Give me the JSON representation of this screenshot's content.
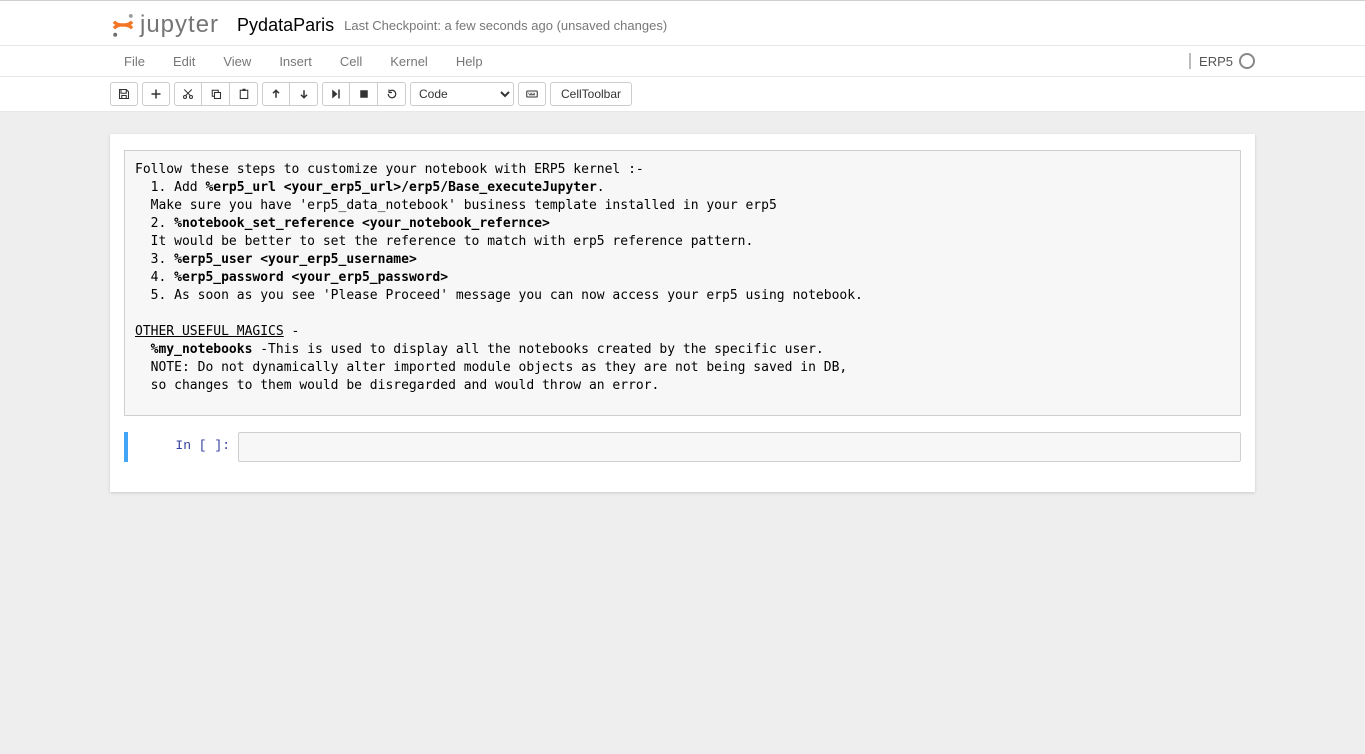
{
  "header": {
    "logo_word": "jupyter",
    "notebook_title": "PydataParis",
    "checkpoint_text": "Last Checkpoint: a few seconds ago (unsaved changes)"
  },
  "menubar": {
    "items": [
      "File",
      "Edit",
      "View",
      "Insert",
      "Cell",
      "Kernel",
      "Help"
    ],
    "kernel_name": "ERP5"
  },
  "toolbar": {
    "cell_type_selected": "Code",
    "celltoolbar_label": "CellToolbar"
  },
  "output": {
    "line_intro": "Follow these steps to customize your notebook with ERP5 kernel :-",
    "step1_prefix": "  1. Add ",
    "step1_bold": "%erp5_url <your_erp5_url>/erp5/Base_executeJupyter",
    "step1_suffix": ".",
    "step1_sub": "  Make sure you have 'erp5_data_notebook' business template installed in your erp5",
    "step2_prefix": "  2. ",
    "step2_bold": "%notebook_set_reference <your_notebook_refernce>",
    "step2_sub": "  It would be better to set the reference to match with erp5 reference pattern.",
    "step3_prefix": "  3. ",
    "step3_bold": "%erp5_user <your_erp5_username>",
    "step4_prefix": "  4. ",
    "step4_bold": "%erp5_password <your_erp5_password>",
    "step5": "  5. As soon as you see 'Please Proceed' message you can now access your erp5 using notebook.",
    "other_header_u": "OTHER USEFUL MAGICS",
    "other_header_suffix": " -",
    "mynb_prefix": "  ",
    "mynb_bold": "%my_notebooks",
    "mynb_desc": " -This is used to display all the notebooks created by the specific user.",
    "note_line1": "  NOTE: Do not dynamically alter imported module objects as they are not being saved in DB,",
    "note_line2": "  so changes to them would be disregarded and would throw an error."
  },
  "code_cell": {
    "prompt": "In [ ]:",
    "value": ""
  }
}
